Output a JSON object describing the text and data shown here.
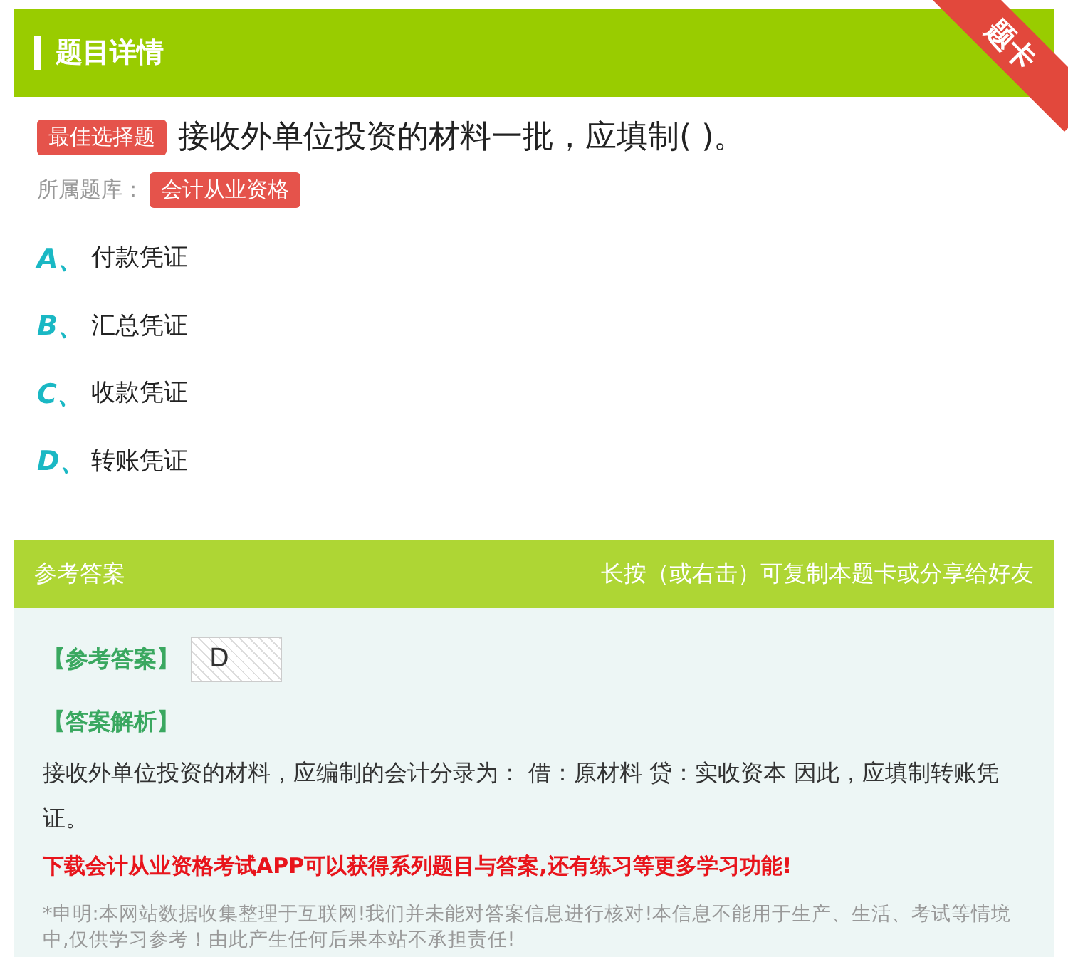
{
  "header": {
    "title": "题目详情",
    "ribbon": "题卡"
  },
  "question": {
    "type_badge": "最佳选择题",
    "text": "接收外单位投资的材料一批，应填制( )。",
    "bank_label": "所属题库：",
    "bank_badge": "会计从业资格"
  },
  "options": [
    {
      "letter": "A、",
      "text": "付款凭证"
    },
    {
      "letter": "B、",
      "text": "汇总凭证"
    },
    {
      "letter": "C、",
      "text": "收款凭证"
    },
    {
      "letter": "D、",
      "text": "转账凭证"
    }
  ],
  "answer": {
    "title": "参考答案",
    "hint": "长按（或右击）可复制本题卡或分享给好友",
    "answer_label": "【参考答案】",
    "answer_value": "D",
    "analysis_label": "【答案解析】",
    "analysis": "接收外单位投资的材料，应编制的会计分录为： 借：原材料 贷：实收资本 因此，应填制转账凭证。",
    "promo": "下载会计从业资格考试APP可以获得系列题目与答案,还有练习等更多学习功能!",
    "disclaimer": "*申明:本网站数据收集整理于互联网!我们并未能对答案信息进行核对!本信息不能用于生产、生活、考试等情境中,仅供学习参考！由此产生任何后果本站不承担责任!"
  }
}
